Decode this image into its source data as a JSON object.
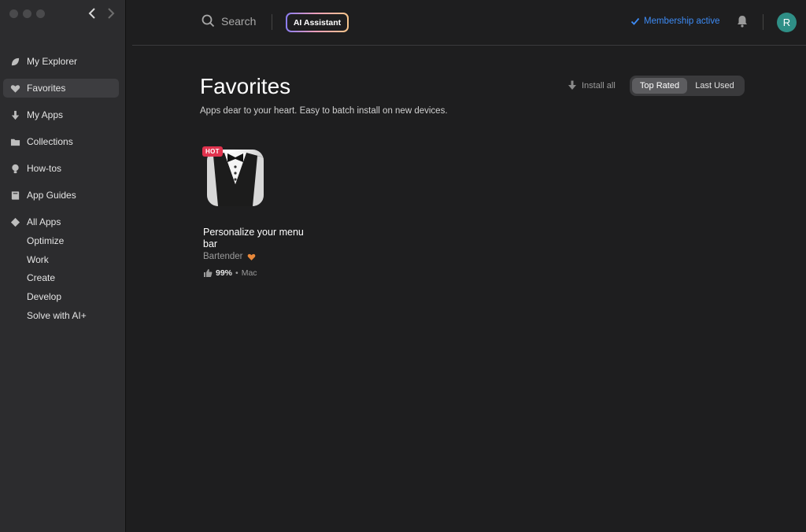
{
  "sidebar": {
    "items": [
      {
        "label": "My Explorer",
        "icon": "leaf-icon"
      },
      {
        "label": "Favorites",
        "icon": "heart-icon",
        "active": true
      },
      {
        "label": "My Apps",
        "icon": "download-arrow-icon"
      },
      {
        "label": "Collections",
        "icon": "folder-icon"
      },
      {
        "label": "How-tos",
        "icon": "lightbulb-icon"
      },
      {
        "label": "App Guides",
        "icon": "book-icon"
      },
      {
        "label": "All Apps",
        "icon": "diamond-icon"
      }
    ],
    "subitems": [
      "Optimize",
      "Work",
      "Create",
      "Develop",
      "Solve with AI+"
    ]
  },
  "topbar": {
    "search_label": "Search",
    "ai_button": "AI Assistant",
    "membership": "Membership active",
    "avatar_initial": "R"
  },
  "main": {
    "title": "Favorites",
    "subtitle": "Apps dear to your heart. Easy to batch install on new devices.",
    "install_all": "Install all",
    "sort_options": [
      "Top Rated",
      "Last Used"
    ],
    "selected_sort": "Top Rated"
  },
  "apps": [
    {
      "badge": "HOT",
      "title": "Personalize your menu bar",
      "developer": "Bartender",
      "rating": "99%",
      "platform": "Mac"
    }
  ],
  "colors": {
    "accent": "#3d8bf5",
    "hot_badge": "#e0334e",
    "heart": "#e8883a",
    "avatar": "#2f8f86"
  }
}
